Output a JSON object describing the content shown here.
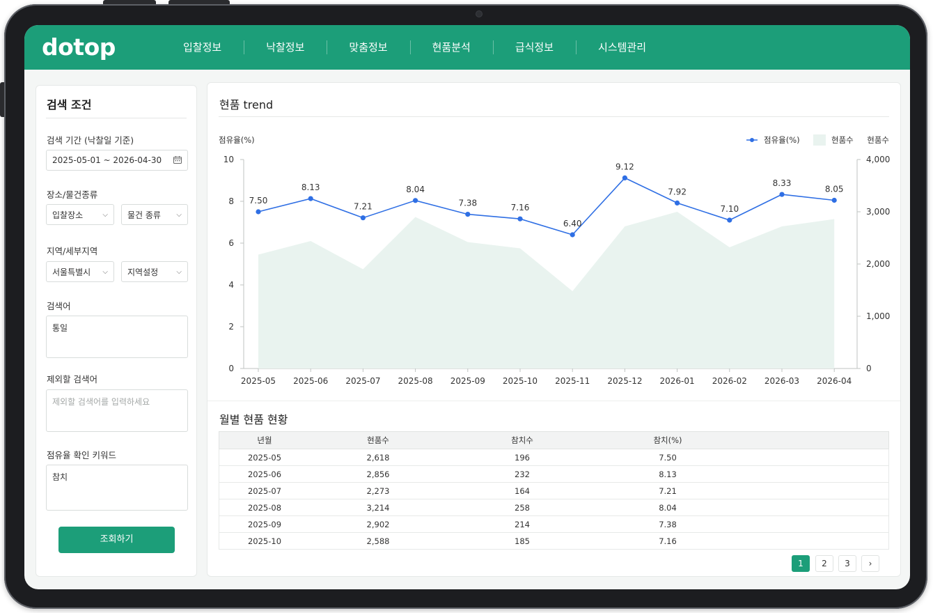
{
  "app": {
    "logo": "dotop",
    "nav": [
      "입찰정보",
      "낙찰정보",
      "맞춤정보",
      "현품분석",
      "급식정보",
      "시스템관리"
    ]
  },
  "sidebar": {
    "title": "검색 조건",
    "period_label": "검색 기간  (낙찰일 기준)",
    "period_value": "2025-05-01 ~ 2026-04-30",
    "place_label": "장소/물건종류",
    "place_select": "입찰장소",
    "item_select": "물건 종류",
    "region_label": "지역/세부지역",
    "region_select": "서울특별시",
    "subregion_select": "지역설정",
    "keyword_label": "검색어",
    "keyword_value": "통일",
    "exclude_label": "제외할 검색어",
    "exclude_placeholder": "제외할 검색어를 입력하세요",
    "share_label": "점유율 확인 키워드",
    "share_value": "참치",
    "search_button": "조회하기"
  },
  "chart_panel": {
    "title": "현품 trend"
  },
  "chart_data": {
    "type": "line",
    "categories": [
      "2025-05",
      "2025-06",
      "2025-07",
      "2025-08",
      "2025-09",
      "2025-10",
      "2025-11",
      "2025-12",
      "2026-01",
      "2026-02",
      "2026-03",
      "2026-04"
    ],
    "series": [
      {
        "name": "점유율(%)",
        "type": "line",
        "axis": "left",
        "values": [
          7.5,
          8.13,
          7.21,
          8.04,
          7.38,
          7.16,
          6.4,
          9.12,
          7.92,
          7.1,
          8.33,
          8.05
        ],
        "labels": [
          "7.50",
          "8.13",
          "7.21",
          "8.04",
          "7.38",
          "7.16",
          "6.40",
          "9.12",
          "7.92",
          "7.10",
          "8.33",
          "8.05"
        ]
      },
      {
        "name": "현품수",
        "type": "area",
        "axis": "right",
        "values": [
          2180,
          2440,
          1900,
          2900,
          2420,
          2300,
          1480,
          2720,
          3000,
          2320,
          2720,
          2860
        ]
      }
    ],
    "ylabel_left": "점유율(%)",
    "ylabel_right": "현품수",
    "ylim_left": [
      0,
      10
    ],
    "ylim_right": [
      0,
      4000
    ],
    "yticks_left": [
      "0",
      "2",
      "4",
      "6",
      "8",
      "10"
    ],
    "yticks_right": [
      "0",
      "1,000",
      "2,000",
      "3,000",
      "4,000"
    ],
    "legend_placement": "top-right",
    "colors": {
      "line": "#2f6fe4",
      "area": "#e9f3ef"
    }
  },
  "table": {
    "title": "월별 현품 현황",
    "columns": [
      "년월",
      "현품수",
      "참치수",
      "참치(%)"
    ],
    "rows": [
      [
        "2025-05",
        "2,618",
        "196",
        "7.50"
      ],
      [
        "2025-06",
        "2,856",
        "232",
        "8.13"
      ],
      [
        "2025-07",
        "2,273",
        "164",
        "7.21"
      ],
      [
        "2025-08",
        "3,214",
        "258",
        "8.04"
      ],
      [
        "2025-09",
        "2,902",
        "214",
        "7.38"
      ],
      [
        "2025-10",
        "2,588",
        "185",
        "7.16"
      ]
    ]
  },
  "pagination": {
    "pages": [
      "1",
      "2",
      "3"
    ],
    "active": "1",
    "next_icon": "chevron-right-icon",
    "next_glyph": "›"
  },
  "icons": {
    "calendar": "calendar-icon",
    "dropdown": "chevron-down-icon",
    "dropdown_glyph": "⌵"
  },
  "colors": {
    "brand": "#1c9e79",
    "page_bg": "#f4f6f5"
  }
}
